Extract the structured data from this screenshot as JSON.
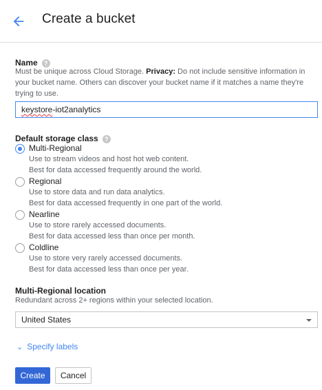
{
  "header": {
    "title": "Create a bucket"
  },
  "name_section": {
    "label": "Name",
    "desc_main": "Must be unique across Cloud Storage. ",
    "privacy_label": "Privacy:",
    "desc_rest": " Do not include sensitive information in your bucket name. Others can discover your bucket name if it matches a name they're trying to use.",
    "value_part1": "keystore",
    "value_part2": "-iot2analytics"
  },
  "storage_class": {
    "label": "Default storage class",
    "options": [
      {
        "label": "Multi-Regional",
        "line1": "Use to stream videos and host hot web content.",
        "line2": "Best for data accessed frequently around the world.",
        "selected": true
      },
      {
        "label": "Regional",
        "line1": "Use to store data and run data analytics.",
        "line2": "Best for data accessed frequently in one part of the world.",
        "selected": false
      },
      {
        "label": "Nearline",
        "line1": "Use to store rarely accessed documents.",
        "line2": "Best for data accessed less than once per month.",
        "selected": false
      },
      {
        "label": "Coldline",
        "line1": "Use to store very rarely accessed documents.",
        "line2": "Best for data accessed less than once per year.",
        "selected": false
      }
    ]
  },
  "location": {
    "label": "Multi-Regional location",
    "desc": "Redundant across 2+ regions within your selected location.",
    "selected": "United States"
  },
  "labels_link": "Specify labels",
  "buttons": {
    "create": "Create",
    "cancel": "Cancel"
  },
  "colors": {
    "accent": "#4285f4",
    "primary_button": "#3367d6"
  },
  "icons": {
    "back": "arrow-back-icon",
    "help": "help-icon",
    "labels": "chevron-double-down-icon"
  }
}
